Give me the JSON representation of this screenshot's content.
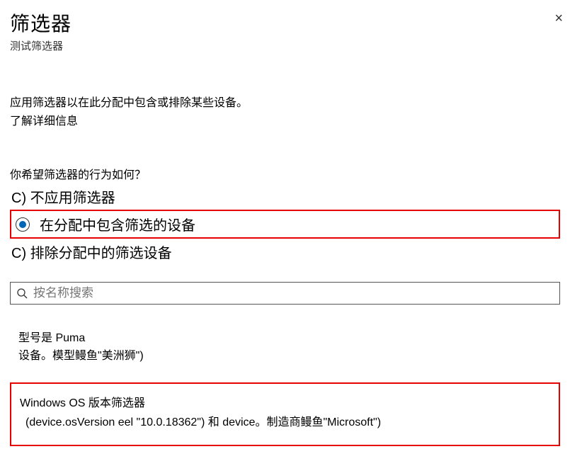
{
  "header": {
    "title": "筛选器",
    "subtitle": "测试筛选器",
    "close_glyph": "×"
  },
  "intro": {
    "description": "应用筛选器以在此分配中包含或排除某些设备。",
    "learn_more": "了解详细信息"
  },
  "behavior": {
    "question": "你希望筛选器的行为如何？",
    "option_prefix": "C)",
    "options": {
      "none": "不应用筛选器",
      "include": "在分配中包含筛选的设备",
      "exclude": "排除分配中的筛选设备"
    }
  },
  "search": {
    "placeholder": "按名称搜索"
  },
  "result": {
    "line1": "型号是 Puma",
    "line2": "设备。模型鳗鱼\"美洲狮\")"
  },
  "highlight": {
    "title": "Windows  OS 版本筛选器",
    "rule": "(device.osVersion eel \"10.0.18362\") 和 device。制造商鳗鱼\"Microsoft\")"
  }
}
